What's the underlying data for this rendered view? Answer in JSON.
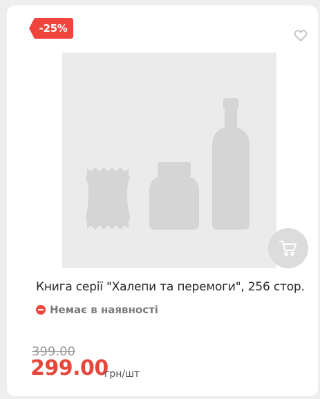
{
  "badge": {
    "discount": "-25%",
    "color": "#f0443d"
  },
  "product": {
    "title": "Книга серії \"Халепи та перемоги\", 256 стор.",
    "image_placeholder": "product-placeholder-image"
  },
  "stock": {
    "status": "Немає в наявності"
  },
  "price": {
    "old": "399.00",
    "current": "299.00",
    "unit": "грн/шт",
    "accent_color": "#e8463a"
  },
  "icons": {
    "wishlist": "heart-icon",
    "cart": "cart-icon",
    "stock": "minus-circle-icon"
  }
}
